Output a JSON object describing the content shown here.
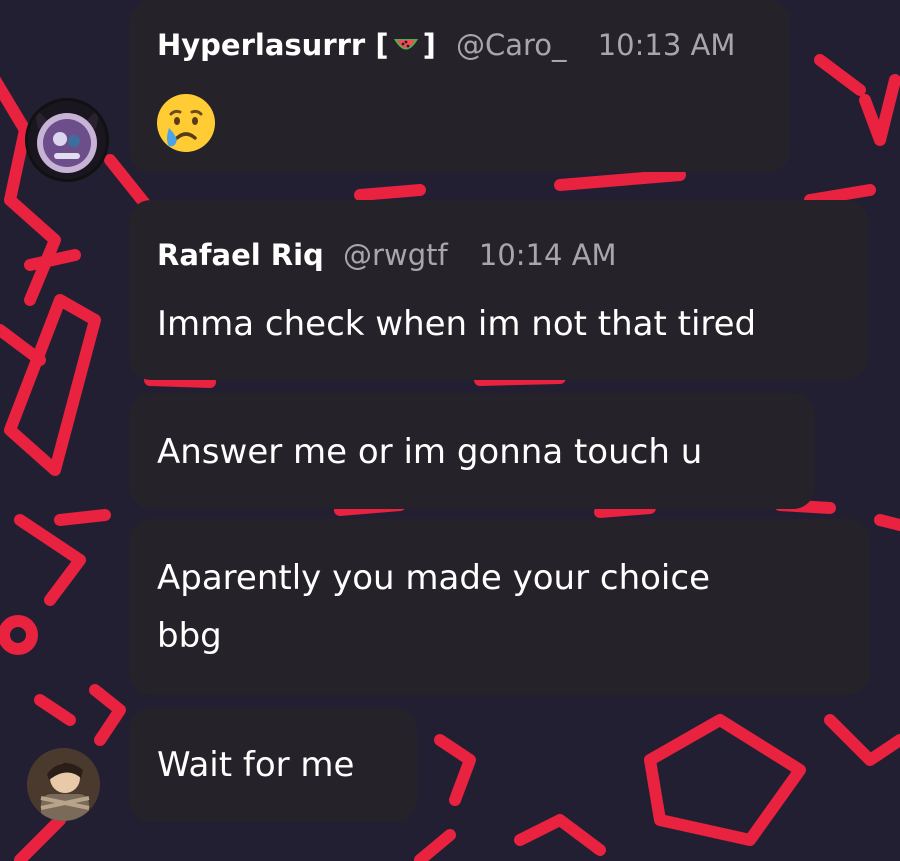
{
  "messages": [
    {
      "author": "Hyperlasurrr [",
      "author_suffix": "]",
      "author_emoji": "watermelon-emoji",
      "handle": "@Caro_",
      "time": "10:13 AM",
      "emoji": "crying-face-emoji"
    },
    {
      "author": "Rafael Riq",
      "handle": "@rwgtf",
      "time": "10:14 AM",
      "text": "Imma check when im not that tired"
    },
    {
      "text": "Answer me or im gonna touch u"
    },
    {
      "text_line1": "Aparently you made your choice",
      "text_line2": "bbg"
    },
    {
      "text": "Wait for me"
    }
  ],
  "colors": {
    "background": "#221f33",
    "pattern": "#e8223f",
    "bubble": "#252329",
    "muted_text": "#a7a6ac"
  },
  "icons": {
    "avatar_top": "avatar-cat-ears",
    "avatar_bottom": "avatar-photo"
  }
}
